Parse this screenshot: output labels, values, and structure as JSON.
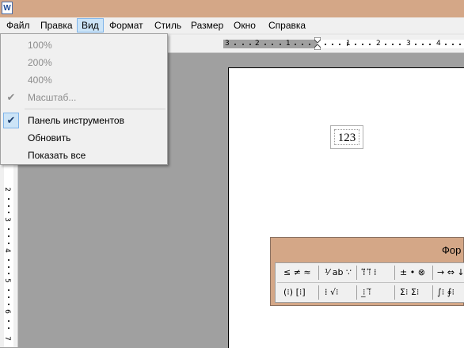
{
  "window": {
    "app_icon_letter": "W"
  },
  "menu": {
    "items": [
      "Файл",
      "Правка",
      "Вид",
      "Формат",
      "Стиль",
      "Размер",
      "Окно",
      "Справка"
    ]
  },
  "view_menu": {
    "zoom_100": "100%",
    "zoom_200": "200%",
    "zoom_400": "400%",
    "zoom_custom": "Масштаб...",
    "toolbar_toggle": "Панель инструментов",
    "refresh": "Обновить",
    "show_all": "Показать все",
    "check_glyph": "✔"
  },
  "ruler_h": {
    "labels": [
      "3",
      "2",
      "1",
      "1",
      "2",
      "3",
      "4"
    ]
  },
  "ruler_v": {
    "labels": [
      "2",
      "3",
      "4",
      "5",
      "6",
      "7"
    ]
  },
  "document": {
    "equation": "123"
  },
  "formula_palette": {
    "title": "Фор",
    "row1": [
      "≤ ≠ ≈",
      "⅟ ab ∵",
      "⁞⃡ ⁝⃡ ⁞",
      "± • ⊗",
      "→ ⇔ ↓"
    ],
    "row2": [
      "(⁝) [⁝]",
      "⁞ √⁝",
      "⁝̲ ⁝̅",
      "Σ⁝ Σ⁝",
      "∫⁝ ∮⁝"
    ]
  }
}
